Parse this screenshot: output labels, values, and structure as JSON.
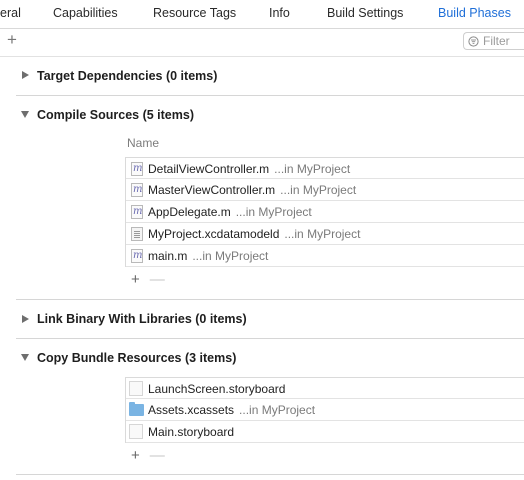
{
  "tabs": [
    {
      "label": "eral"
    },
    {
      "label": "Capabilities"
    },
    {
      "label": "Resource Tags"
    },
    {
      "label": "Info"
    },
    {
      "label": "Build Settings"
    },
    {
      "label": "Build Phases"
    }
  ],
  "active_tab": "Build Phases",
  "toolbar": {
    "add_label": "+",
    "filter_placeholder": "Filter"
  },
  "phases": [
    {
      "title": "Target Dependencies (0 items)",
      "expanded": false
    },
    {
      "title": "Compile Sources (5 items)",
      "expanded": true,
      "column_header": "Name",
      "files": [
        {
          "name": "DetailViewController.m",
          "location": "...in MyProject",
          "icon": "m-file-icon"
        },
        {
          "name": "MasterViewController.m",
          "location": "...in MyProject",
          "icon": "m-file-icon"
        },
        {
          "name": "AppDelegate.m",
          "location": "...in MyProject",
          "icon": "m-file-icon"
        },
        {
          "name": "MyProject.xcdatamodeld",
          "location": "...in MyProject",
          "icon": "datamodel-icon"
        },
        {
          "name": "main.m",
          "location": "...in MyProject",
          "icon": "m-file-icon"
        }
      ]
    },
    {
      "title": "Link Binary With Libraries (0 items)",
      "expanded": false
    },
    {
      "title": "Copy Bundle Resources (3 items)",
      "expanded": true,
      "files": [
        {
          "name": "LaunchScreen.storyboard",
          "location": "",
          "icon": "storyboard-icon"
        },
        {
          "name": "Assets.xcassets",
          "location": "...in MyProject",
          "icon": "folder-icon"
        },
        {
          "name": "Main.storyboard",
          "location": "",
          "icon": "storyboard-icon"
        }
      ]
    }
  ],
  "add_remove": {
    "add": "+",
    "remove": "—"
  },
  "colors": {
    "accent": "#1f6fd8",
    "separator": "#d6d6d6"
  }
}
